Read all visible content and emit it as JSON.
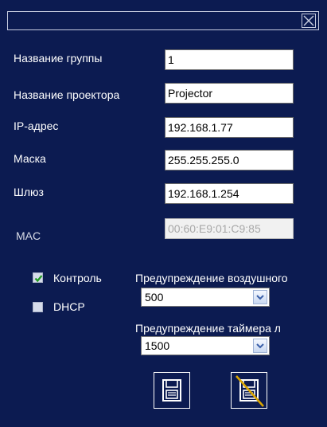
{
  "form": {
    "group_name_label": "Название группы",
    "group_name_value": "1",
    "projector_name_label": "Название проектора",
    "projector_name_value": "Projector",
    "ip_label": "IP-адрес",
    "ip_value": "192.168.1.77",
    "mask_label": "Маска",
    "mask_value": "255.255.255.0",
    "gateway_label": "Шлюз",
    "gateway_value": "192.168.1.254",
    "mac_label": "MAC",
    "mac_value": "00:60:E9:01:C9:85"
  },
  "options": {
    "control_label": "Контроль",
    "control_checked": true,
    "dhcp_label": "DHCP",
    "dhcp_checked": false,
    "air_warning_label": "Предупреждение воздушного",
    "air_warning_value": "500",
    "timer_warning_label": "Предупреждение таймера л",
    "timer_warning_value": "1500"
  },
  "icons": {
    "close": "close-icon",
    "save": "save-icon",
    "cancel_save": "cancel-save-icon"
  },
  "colors": {
    "background": "#0c1b51",
    "text": "#ffffff",
    "check": "#1f9a1f",
    "strike": "#d9a400"
  }
}
